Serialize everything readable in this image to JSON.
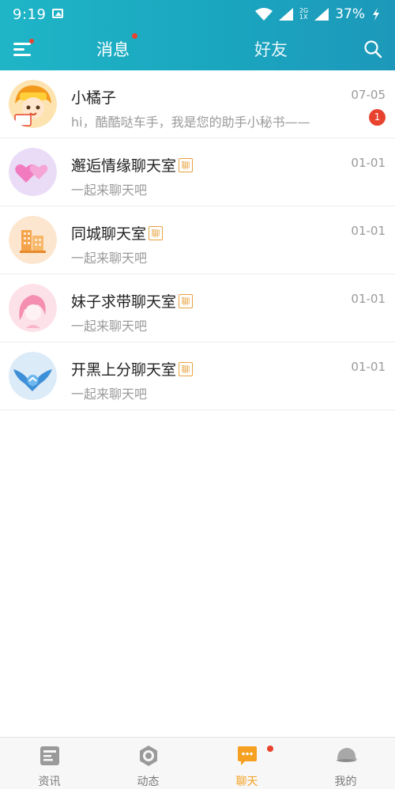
{
  "status_bar": {
    "time": "9:19",
    "network_top": "2G",
    "network_bottom": "1X",
    "battery": "37%"
  },
  "header": {
    "tab_messages": "消息",
    "tab_friends": "好友"
  },
  "conversations": [
    {
      "name": "小橘子",
      "message": "hi，酷酷哒车手，我是您的助手小秘书——",
      "date": "07-05",
      "unread": "1",
      "avatar": "orange-girl-avatar"
    },
    {
      "name": "邂逅情缘聊天室",
      "tag": "聊",
      "message": "一起来聊天吧",
      "date": "01-01",
      "avatar": "hearts-avatar"
    },
    {
      "name": "同城聊天室",
      "tag": "聊",
      "message": "一起来聊天吧",
      "date": "01-01",
      "avatar": "city-buildings-avatar"
    },
    {
      "name": "妹子求带聊天室",
      "tag": "聊",
      "message": "一起来聊天吧",
      "date": "01-01",
      "avatar": "girl-avatar"
    },
    {
      "name": "开黑上分聊天室",
      "tag": "聊",
      "message": "一起来聊天吧",
      "date": "01-01",
      "avatar": "wings-avatar"
    }
  ],
  "bottom_nav": [
    {
      "label": "资讯",
      "icon": "news-icon"
    },
    {
      "label": "动态",
      "icon": "moments-icon"
    },
    {
      "label": "聊天",
      "icon": "chat-icon",
      "active": true
    },
    {
      "label": "我的",
      "icon": "profile-icon"
    }
  ],
  "colors": {
    "header": "#1aa6bf",
    "accent": "#f5a020",
    "badge": "#e8432e",
    "tag": "#e7a33f"
  }
}
